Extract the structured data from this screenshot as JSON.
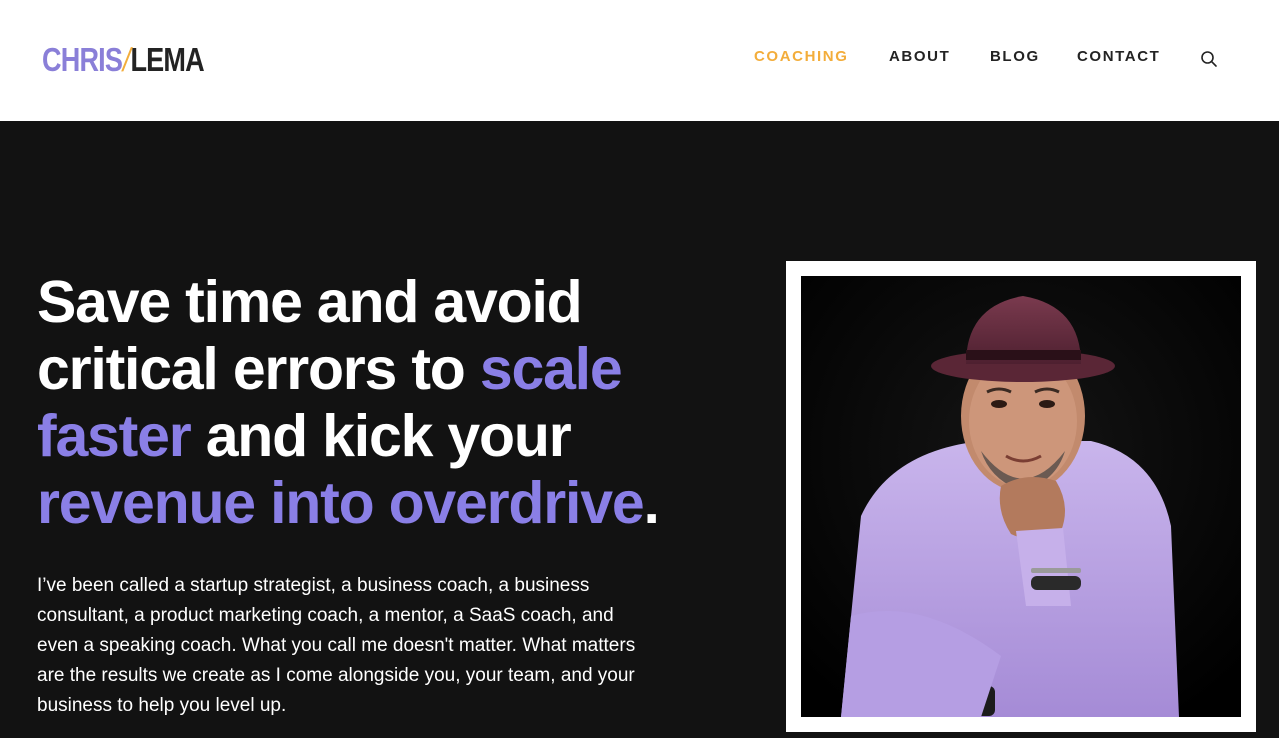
{
  "logo": {
    "first": "CHRIS",
    "slash": "/",
    "last": "LEMA"
  },
  "nav": {
    "items": [
      {
        "label": "COACHING",
        "active": true
      },
      {
        "label": "ABOUT",
        "active": false
      },
      {
        "label": "BLOG",
        "active": false
      },
      {
        "label": "CONTACT",
        "active": false
      }
    ],
    "search_icon": "search-icon"
  },
  "hero": {
    "headline": {
      "line1": "Save time and avoid",
      "line2_a": "critical errors to ",
      "line2_b": "scale",
      "line3_a": "faster",
      "line3_b": " and kick your",
      "line4_a": "revenue into overdrive",
      "line4_b": "."
    },
    "intro": "I’ve been called a startup strategist, a business coach, a business consultant, a product marketing coach, a mentor, a SaaS coach, and even a speaking coach. What you call me doesn't matter. What matters are the results we create as I come alongside you, your team, and your business to help you level up."
  },
  "colors": {
    "accent_purple": "#8a7fe6",
    "accent_orange": "#f3ad3b",
    "dark_bg": "#121212"
  }
}
